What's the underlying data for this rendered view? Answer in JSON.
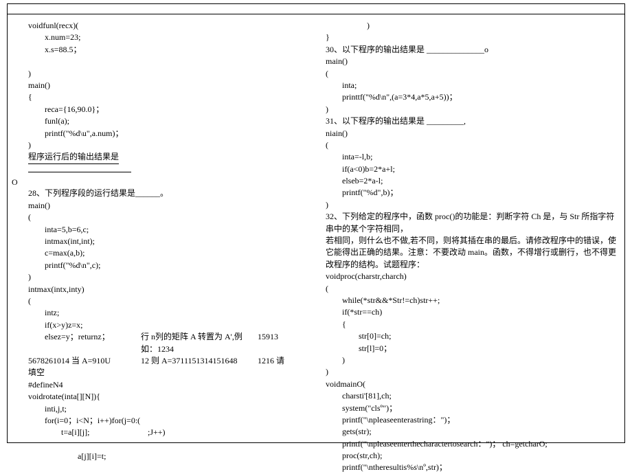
{
  "left": {
    "l1": "voidfunl(recx)(",
    "l2": "x.num=23;",
    "l3": "x.s=88.5；",
    "l4": ")",
    "l5": "main()",
    "l6": "{",
    "l7": "reca={16,90.0}；",
    "l8": "funl(a);",
    "l9": "printf(\"%d\\u\",a.num)；",
    "l10": ")",
    "l11": "程序运行后的输出结果是",
    "O": "O",
    "l12": "28、下列程序段的运行结果是______。",
    "l13": "main()",
    "l14": "(",
    "l15": "inta=5,b=6,c;",
    "l16": "intmax(int,int);",
    "l17": "c=max(a,b);",
    "l18": "printf(\"%d\\n\",c);",
    "l19": ")",
    "l20": "intmax(intx,inty)",
    "l21": "(",
    "l22": "intz;",
    "l23": "if(x>y)z=x;",
    "row1a": "elsez=y；returnz；",
    "row1b": "行 n列的矩阵 A 转置为 A',例如：1234",
    "row1c": "15913",
    "row2a": "5678261014 当 A=910U",
    "row2b": "12  则 A=3711151314151648",
    "row2c": "1216 请",
    "l24": "填空",
    "l25": "#defineN4",
    "l26": "voidrotate(inta[][N]){",
    "l27": "inti,j,t;",
    "l28": "for(i=0；i<N；i++)for(j=0:(",
    "l29a": "t=a[i][j];",
    "l29b": ";J++)",
    "l30": "a[j][i]=t;"
  },
  "right": {
    "r1": ")",
    "r2": "}",
    "r3": "30、以下程序的输出结果是 ______________o",
    "r4": "main()",
    "r5": "(",
    "r6": "inta;",
    "r7": "printtf(\"%d\\n\",(a=3*4,a*5,a+5))；",
    "r8": ")",
    "r9": "31、以下程序的输出结果是 _________,",
    "r10": "niain()",
    "r11": "(",
    "r12": "inta=-l,b;",
    "r13": "if(a<0)b=2*a+l;",
    "r14": "elseb=2*a-l;",
    "r15": "printf(\"%d\",b)；",
    "r16": ")",
    "r17": "32、下列给定的程序中，函数 proc()的功能是：判断字符 Ch 是，与 Str 所指字符串中的某个字符相同，",
    "r18": "若相同，则什么也不做,若不同，则将其插在串的最后。请修改程序中的错误，使它能得出正确的结果。注意：不要改动 main。函数，不得增行或删行，也不得更改程序的结构。试题程序：",
    "r19": "voidproc(charstr,charch)",
    "r20": "(",
    "r21": "while(*str&&*Str!=ch)str++;",
    "r22": "if(*str==ch)",
    "r23": "{",
    "r24": "str[0]=ch;",
    "r25": "str[l]=0；",
    "r26": ")",
    "r27": ")",
    "r28": "voidmainO(",
    "r29": "charsti'[81],ch;",
    "r30": "system(\"clsº\")；",
    "r31": "printf(\"\\npleaseenterastring：\")；",
    "r32": "gets(str);",
    "r33": "printf(\"\\npleaseenterthecharactertosearch：\")； ch=getcharO;",
    "r34": "proc(str,ch);",
    "r35": "printf(\"\\ntheresultis%s\\nº,str)；"
  }
}
